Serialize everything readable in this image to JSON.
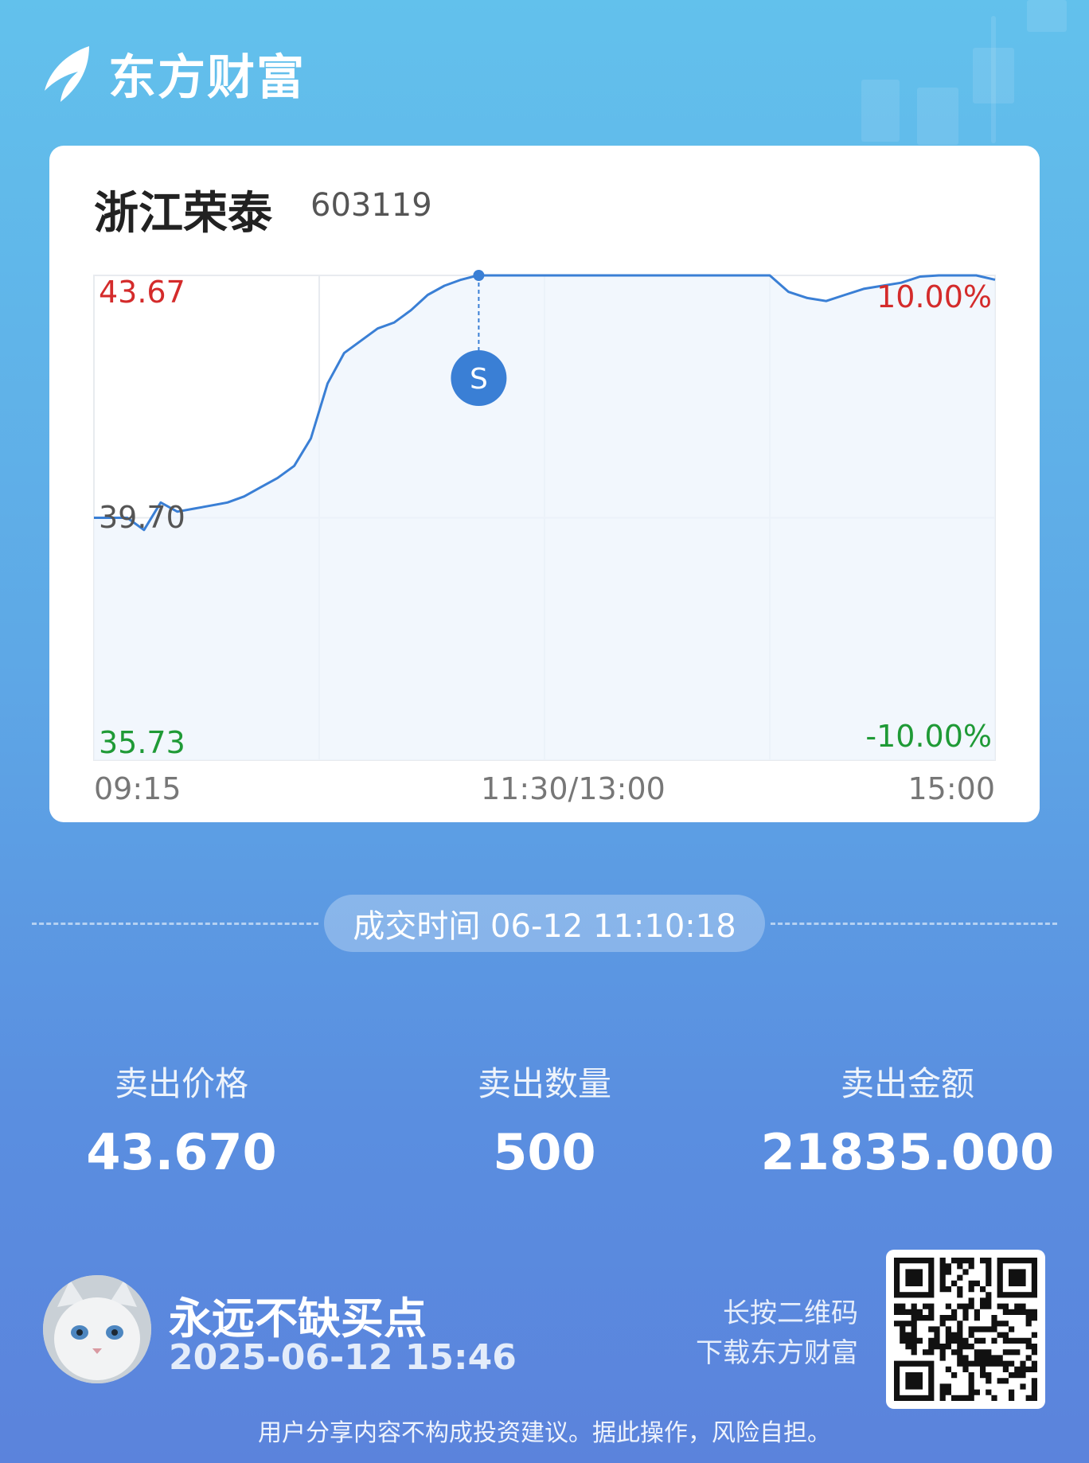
{
  "brand": {
    "name": "东方财富"
  },
  "stock": {
    "name": "浙江荣泰",
    "code": "603119"
  },
  "chart": {
    "price_high": "43.67",
    "price_mid": "39.70",
    "price_low": "35.73",
    "pct_high": "10.00%",
    "pct_low": "-10.00%",
    "time_start": "09:15",
    "time_mid": "11:30/13:00",
    "time_end": "15:00",
    "marker_label": "S"
  },
  "chart_data": {
    "type": "line",
    "title": "",
    "ylim": [
      35.73,
      43.67
    ],
    "x_ticks": [
      "09:15",
      "11:30/13:00",
      "15:00"
    ],
    "series": [
      {
        "x": [
          "09:15",
          "09:25",
          "09:30",
          "09:35",
          "09:40",
          "09:45",
          "09:50",
          "09:55",
          "10:00",
          "10:05",
          "10:10",
          "10:15",
          "10:20",
          "10:25",
          "10:30",
          "10:35",
          "10:40",
          "10:45",
          "10:50",
          "10:55",
          "11:00",
          "11:05",
          "11:10",
          "11:15",
          "11:20",
          "11:25",
          "11:30",
          "13:00",
          "13:30",
          "14:00",
          "14:05",
          "14:10",
          "14:15",
          "14:20",
          "14:25",
          "14:30",
          "14:35",
          "14:40",
          "14:45",
          "14:50",
          "14:55",
          "15:00"
        ],
        "y": [
          39.7,
          39.7,
          39.5,
          39.95,
          39.8,
          39.85,
          39.9,
          39.95,
          40.05,
          40.2,
          40.35,
          40.55,
          41.0,
          41.9,
          42.4,
          42.6,
          42.8,
          42.9,
          43.1,
          43.35,
          43.5,
          43.6,
          43.67,
          43.67,
          43.67,
          43.67,
          43.67,
          43.67,
          43.67,
          43.67,
          43.4,
          43.3,
          43.25,
          43.35,
          43.45,
          43.5,
          43.55,
          43.65,
          43.67,
          43.67,
          43.67,
          43.6
        ]
      }
    ],
    "annotations": [
      {
        "label": "S",
        "x": "11:10:18",
        "y": 43.67
      }
    ]
  },
  "trade": {
    "time_text": "成交时间 06-12 11:10:18"
  },
  "stats": [
    {
      "label": "卖出价格",
      "value": "43.670"
    },
    {
      "label": "卖出数量",
      "value": "500"
    },
    {
      "label": "卖出金额",
      "value": "21835.000"
    }
  ],
  "user": {
    "name": "永远不缺买点",
    "share_time": "2025-06-12 15:46"
  },
  "qr": {
    "hint_line1": "长按二维码",
    "hint_line2": "下载东方财富"
  },
  "disclaimer": "用户分享内容不构成投资建议。据此操作，风险自担。",
  "colors": {
    "up": "#d42b2b",
    "down": "#1f9a36",
    "line": "#3a7fd5",
    "marker": "#3a7fd5"
  }
}
